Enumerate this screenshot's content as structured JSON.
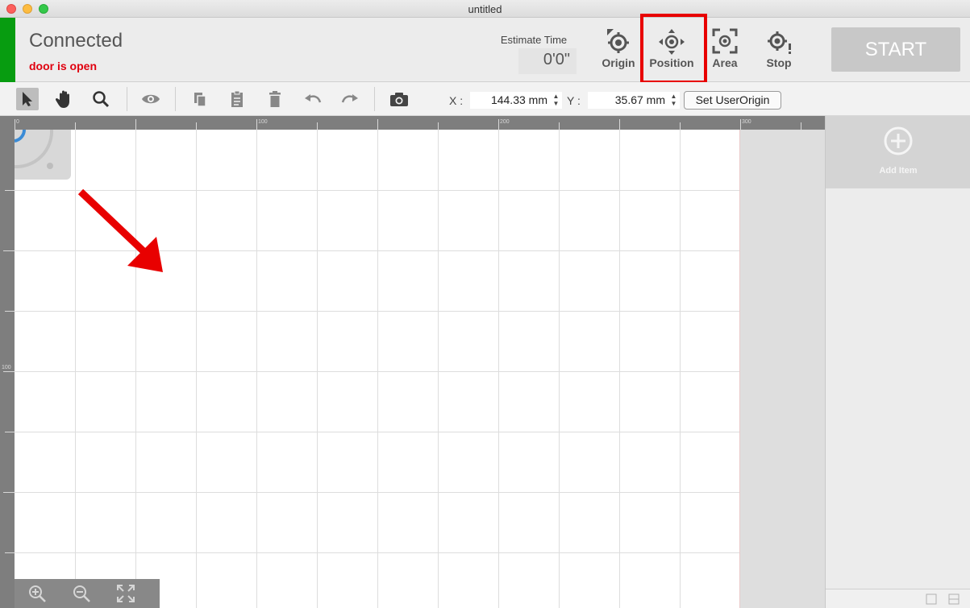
{
  "window": {
    "title": "untitled"
  },
  "status": {
    "connection": "Connected",
    "door": "door is open",
    "indicator_color": "#079c10"
  },
  "estimate": {
    "label": "Estimate Time",
    "value": "0'0\""
  },
  "header_buttons": [
    {
      "label": "Origin",
      "icon": "origin-icon"
    },
    {
      "label": "Position",
      "icon": "position-icon"
    },
    {
      "label": "Area",
      "icon": "area-icon"
    },
    {
      "label": "Stop",
      "icon": "stop-icon"
    }
  ],
  "start": {
    "label": "START"
  },
  "toolbar": {
    "tools": [
      "select-arrow-icon",
      "hand-icon",
      "zoom-icon",
      "eye-icon",
      "copy-icon",
      "paste-icon",
      "trash-icon",
      "undo-icon",
      "redo-icon",
      "camera-icon"
    ],
    "x_label": "X :",
    "x_value": "144.33 mm",
    "y_label": "Y :",
    "y_value": "35.67 mm",
    "set_origin": "Set UserOrigin"
  },
  "rulers": {
    "top": [
      "0",
      "100",
      "200",
      "300"
    ],
    "left": [
      "100"
    ]
  },
  "sidebar": {
    "add_item": "Add Item"
  },
  "colors": {
    "highlight": "#e80000",
    "arrow": "#e80000",
    "start_bg": "#c8c8c8"
  }
}
